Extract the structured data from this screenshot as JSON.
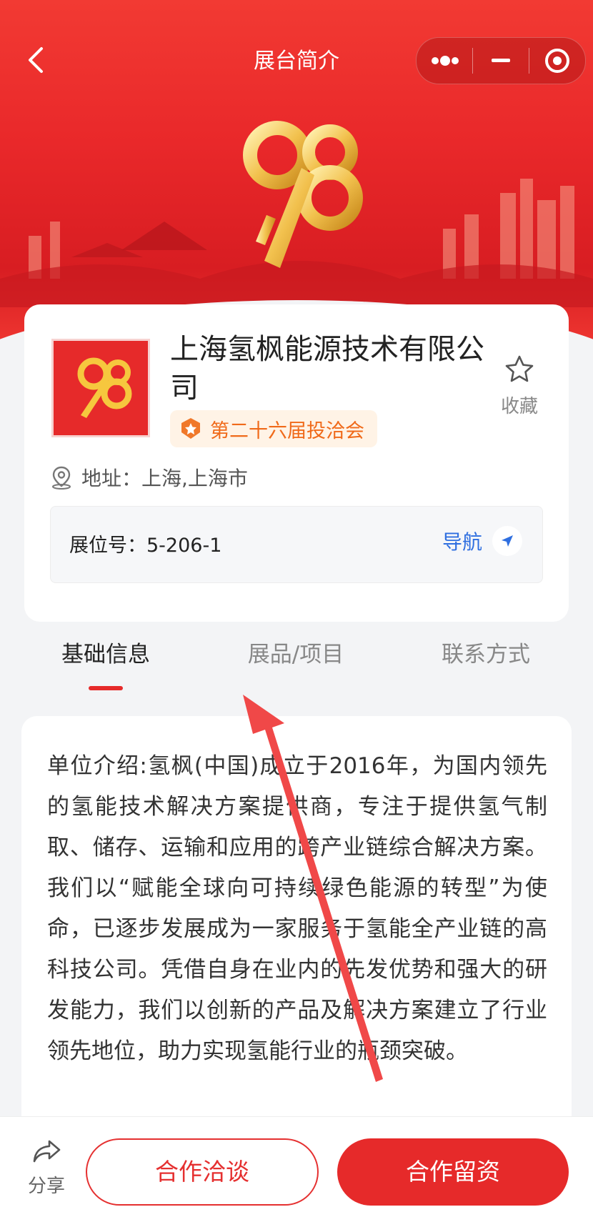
{
  "header": {
    "title": "展台简介",
    "back_icon": "chevron-left-icon",
    "capsule": [
      "more-dots-icon",
      "minimize-icon",
      "close-target-icon"
    ]
  },
  "banner": {
    "emblem_text": "98",
    "colors": {
      "banner_red": "#e9282a",
      "gold": "#f2c14e"
    }
  },
  "company": {
    "name": "上海氢枫能源技术有限公司",
    "badge": "第二十六届投洽会",
    "favorite_label": "收藏",
    "address_label": "地址：",
    "address_value": "上海,上海市",
    "booth_label": "展位号：",
    "booth_value": "5-206-1",
    "nav_label": "导航"
  },
  "tabs": [
    {
      "label": "基础信息",
      "active": true
    },
    {
      "label": "展品/项目",
      "active": false
    },
    {
      "label": "联系方式",
      "active": false
    }
  ],
  "description": "单位介绍:氢枫(中国)成立于2016年，为国内领先的氢能技术解决方案提供商，专注于提供氢气制取、储存、运输和应用的跨产业链综合解决方案。 我们以“赋能全球向可持续绿色能源的转型”为使命，已逐步发展成为一家服务于氢能全产业链的高科技公司。凭借自身在业内的先发优势和强大的研发能力，我们以创新的产品及解决方案建立了行业领先地位，助力实现氢能行业的瓶颈突破。",
  "bottom": {
    "share_label": "分享",
    "negotiate_label": "合作洽谈",
    "invest_label": "合作留资"
  },
  "accent_color": "#e62a2a",
  "link_color": "#2f6fe0"
}
